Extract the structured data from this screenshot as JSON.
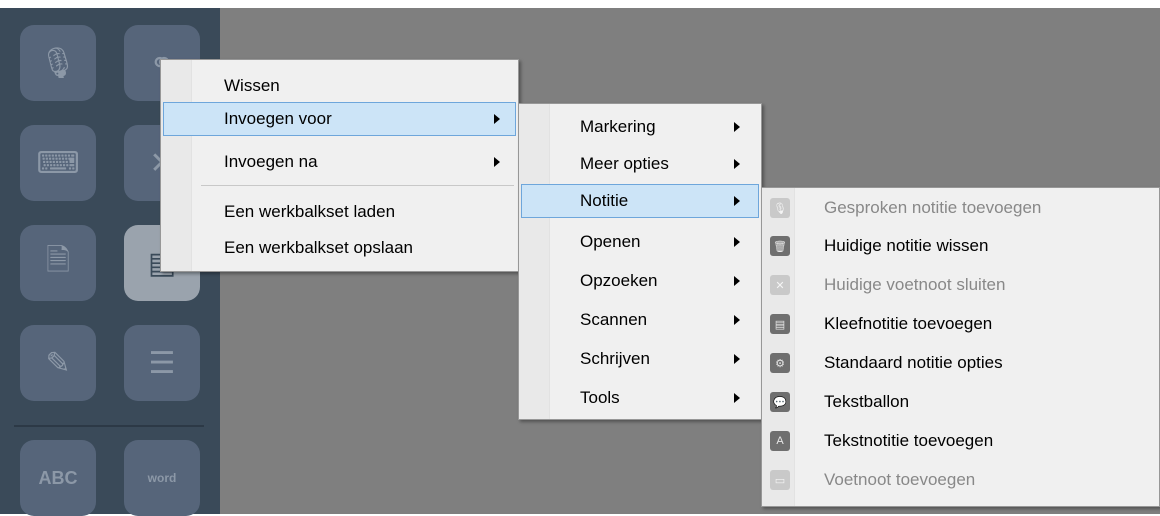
{
  "toolbar": {
    "buttons": [
      {
        "icon": "microphone-icon",
        "glyph": "🎙"
      },
      {
        "icon": "link-icon",
        "glyph": "⚭"
      },
      {
        "icon": "keyboard-icon",
        "glyph": "⌨"
      },
      {
        "icon": "close-icon",
        "glyph": "✕"
      },
      {
        "icon": "document-icon",
        "glyph": "🗎"
      },
      {
        "icon": "footnote-icon",
        "glyph": "▤"
      },
      {
        "icon": "notes-icon",
        "glyph": "✎"
      },
      {
        "icon": "checklist-icon",
        "glyph": "☰"
      },
      {
        "icon": "spellcheck-icon",
        "glyph": "ABC"
      },
      {
        "icon": "word-prediction-icon",
        "glyph": "word"
      }
    ]
  },
  "context_menu": {
    "items": [
      {
        "label": "Wissen"
      },
      {
        "label": "Invoegen voor",
        "submenu": true,
        "selected": true
      },
      {
        "label": "Invoegen na",
        "submenu": true
      },
      {
        "label": "Een werkbalkset laden"
      },
      {
        "label": "Een werkbalkset opslaan"
      }
    ]
  },
  "submenu": {
    "items": [
      {
        "label": "Markering"
      },
      {
        "label": "Meer opties"
      },
      {
        "label": "Notitie",
        "selected": true
      },
      {
        "label": "Openen"
      },
      {
        "label": "Opzoeken"
      },
      {
        "label": "Scannen"
      },
      {
        "label": "Schrijven"
      },
      {
        "label": "Tools"
      }
    ]
  },
  "notitie_menu": {
    "items": [
      {
        "label": "Gesproken notitie toevoegen",
        "icon": "microphone-icon",
        "glyph": "🎙",
        "disabled": true
      },
      {
        "label": "Huidige notitie wissen",
        "icon": "trash-icon",
        "glyph": "🗑",
        "disabled": false
      },
      {
        "label": "Huidige voetnoot sluiten",
        "icon": "close-icon",
        "glyph": "✕",
        "disabled": true
      },
      {
        "label": "Kleefnotitie toevoegen",
        "icon": "sticky-note-icon",
        "glyph": "▤",
        "disabled": false
      },
      {
        "label": "Standaard notitie opties",
        "icon": "note-options-icon",
        "glyph": "⚙",
        "disabled": false
      },
      {
        "label": "Tekstballon",
        "icon": "speech-bubble-icon",
        "glyph": "💬",
        "disabled": false
      },
      {
        "label": "Tekstnotitie toevoegen",
        "icon": "text-note-icon",
        "glyph": "A",
        "disabled": false
      },
      {
        "label": "Voetnoot toevoegen",
        "icon": "footnote-icon",
        "glyph": "▭",
        "disabled": true
      }
    ]
  }
}
